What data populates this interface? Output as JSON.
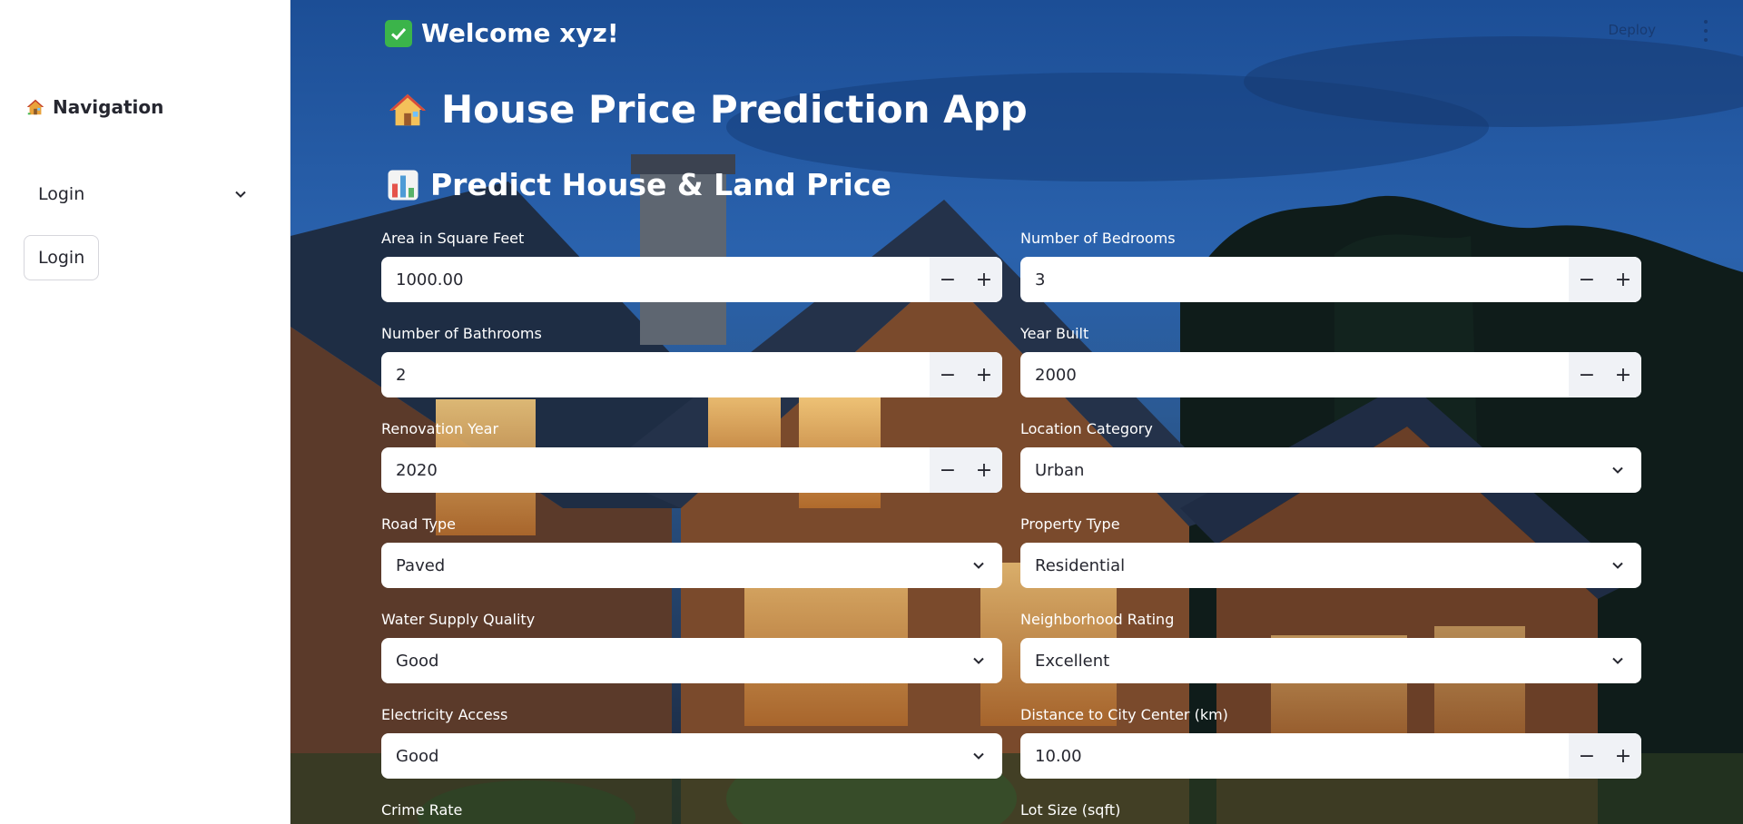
{
  "sidebar": {
    "title": "Navigation",
    "title_icon": "house-icon",
    "select_value": "Login",
    "button_label": "Login"
  },
  "header": {
    "deploy_label": "Deploy",
    "welcome": "Welcome xyz!",
    "welcome_icon": "check-icon"
  },
  "main": {
    "app_title": "House Price Prediction App",
    "app_title_icon": "house-icon",
    "section_title": "Predict House & Land Price",
    "section_title_icon": "chart-icon"
  },
  "form": {
    "area": {
      "label": "Area in Square Feet",
      "value": "1000.00",
      "type": "number"
    },
    "bedrooms": {
      "label": "Number of Bedrooms",
      "value": "3",
      "type": "number"
    },
    "bathrooms": {
      "label": "Number of Bathrooms",
      "value": "2",
      "type": "number"
    },
    "year_built": {
      "label": "Year Built",
      "value": "2000",
      "type": "number"
    },
    "renovation_year": {
      "label": "Renovation Year",
      "value": "2020",
      "type": "number"
    },
    "location_category": {
      "label": "Location Category",
      "value": "Urban",
      "type": "select"
    },
    "road_type": {
      "label": "Road Type",
      "value": "Paved",
      "type": "select"
    },
    "property_type": {
      "label": "Property Type",
      "value": "Residential",
      "type": "select"
    },
    "water_supply": {
      "label": "Water Supply Quality",
      "value": "Good",
      "type": "select"
    },
    "neighborhood_rating": {
      "label": "Neighborhood Rating",
      "value": "Excellent",
      "type": "select"
    },
    "electricity_access": {
      "label": "Electricity Access",
      "value": "Good",
      "type": "select"
    },
    "distance_city_center": {
      "label": "Distance to City Center (km)",
      "value": "10.00",
      "type": "number"
    },
    "crime_rate": {
      "label": "Crime Rate"
    },
    "lot_size": {
      "label": "Lot Size (sqft)"
    }
  },
  "colors": {
    "sidebar_bg": "#ffffff",
    "text_primary": "#262730",
    "stepper_bg": "#f0f2f6",
    "welcome_check": "#3bb44a"
  }
}
